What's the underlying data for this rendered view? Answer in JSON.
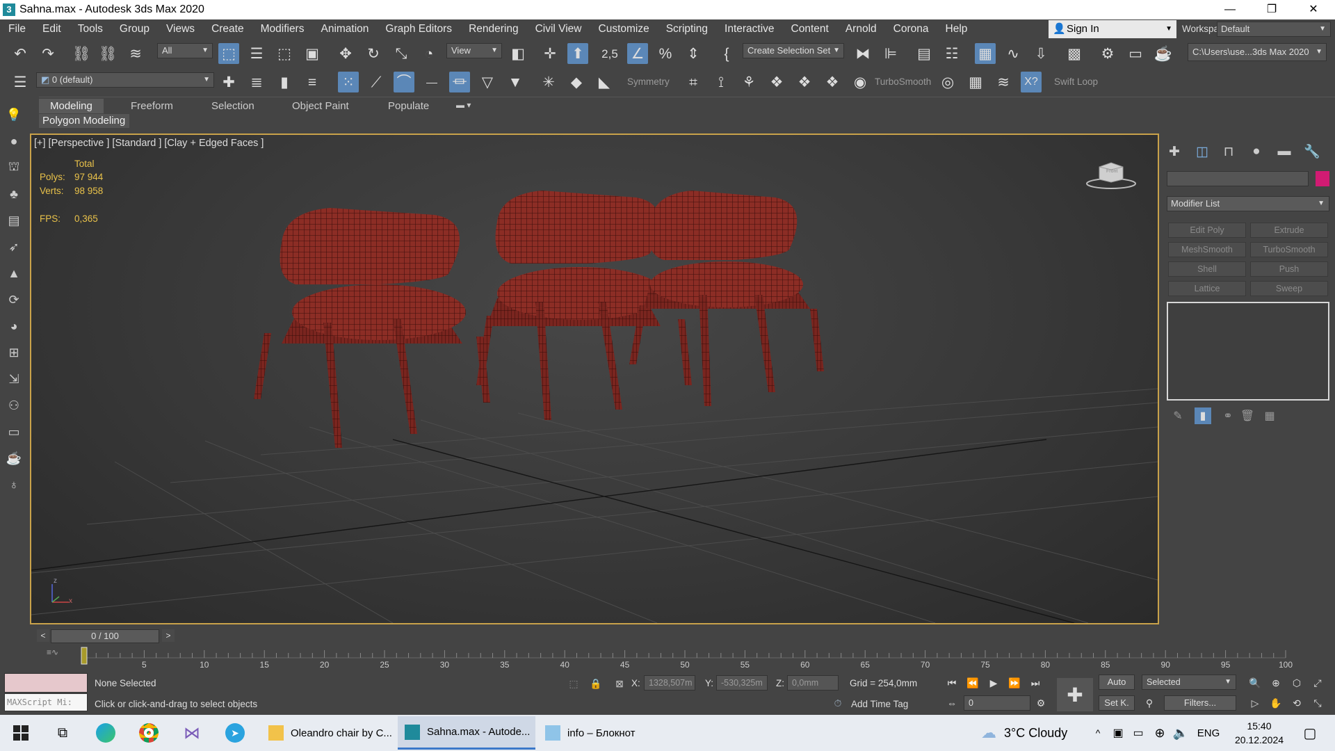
{
  "window": {
    "title": "Sahna.max - Autodesk 3ds Max 2020",
    "app_icon": "3",
    "minimize": "—",
    "maximize": "❐",
    "close": "✕"
  },
  "menu": [
    "File",
    "Edit",
    "Tools",
    "Group",
    "Views",
    "Create",
    "Modifiers",
    "Animation",
    "Graph Editors",
    "Rendering",
    "Civil View",
    "Customize",
    "Scripting",
    "Interactive",
    "Content",
    "Arnold",
    "Corona",
    "Help"
  ],
  "account": {
    "sign_in": "Sign In",
    "workspaces_label": "Workspaces:",
    "workspace": "Default"
  },
  "toolbar1": {
    "selection_filter": "All",
    "ref_coord": "View",
    "named_sel": "Create Selection Set",
    "snap_label": "2,5",
    "project_path": "C:\\Users\\use...3ds Max 2020"
  },
  "toolbar2": {
    "layer": "0 (default)",
    "symmetry": "Symmetry",
    "turbosmooth": "TurboSmooth",
    "swift_loop": "Swift Loop"
  },
  "ribbon": {
    "tabs": [
      "Modeling",
      "Freeform",
      "Selection",
      "Object Paint",
      "Populate"
    ],
    "active": "Modeling",
    "panel": "Polygon Modeling"
  },
  "viewport": {
    "label": "[+] [Perspective ] [Standard ] [Clay + Edged Faces ]",
    "stats": {
      "total_label": "Total",
      "polys_label": "Polys:",
      "polys": "97 944",
      "verts_label": "Verts:",
      "verts": "98 958",
      "fps_label": "FPS:",
      "fps": "0,365"
    },
    "viewcube_text": "Front",
    "gizmo": {
      "x": "x",
      "z": "z"
    }
  },
  "command_panel": {
    "modifier_list": "Modifier List",
    "buttons": [
      "Edit Poly",
      "Extrude",
      "MeshSmooth",
      "TurboSmooth",
      "Shell",
      "Push",
      "Lattice",
      "Sweep"
    ],
    "color_swatch": "#d11b73"
  },
  "timeline": {
    "frame": "0 / 100",
    "prev": "<",
    "next": ">",
    "ticks": [
      0,
      5,
      10,
      15,
      20,
      25,
      30,
      35,
      40,
      45,
      50,
      55,
      60,
      65,
      70,
      75,
      80,
      85,
      90,
      95,
      100
    ],
    "current": 0,
    "end": 100
  },
  "status": {
    "maxscript": "MAXScript Mi:",
    "selection": "None Selected",
    "prompt": "Click or click-and-drag to select objects",
    "x_label": "X:",
    "x": "1328,507m",
    "y_label": "Y:",
    "y": "-530,325m",
    "z_label": "Z:",
    "z": "0,0mm",
    "grid": "Grid = 254,0mm",
    "add_time_tag": "Add Time Tag",
    "auto": "Auto",
    "set_key": "Set K.",
    "selected": "Selected",
    "filters": "Filters...",
    "frame_spinner": "0"
  },
  "taskbar": {
    "apps": [
      "Oleandro chair by C...",
      "Sahna.max - Autode...",
      "info – Блокнот"
    ],
    "weather": "3°C  Cloudy",
    "lang": "ENG",
    "time": "15:40",
    "date": "20.12.2024"
  }
}
